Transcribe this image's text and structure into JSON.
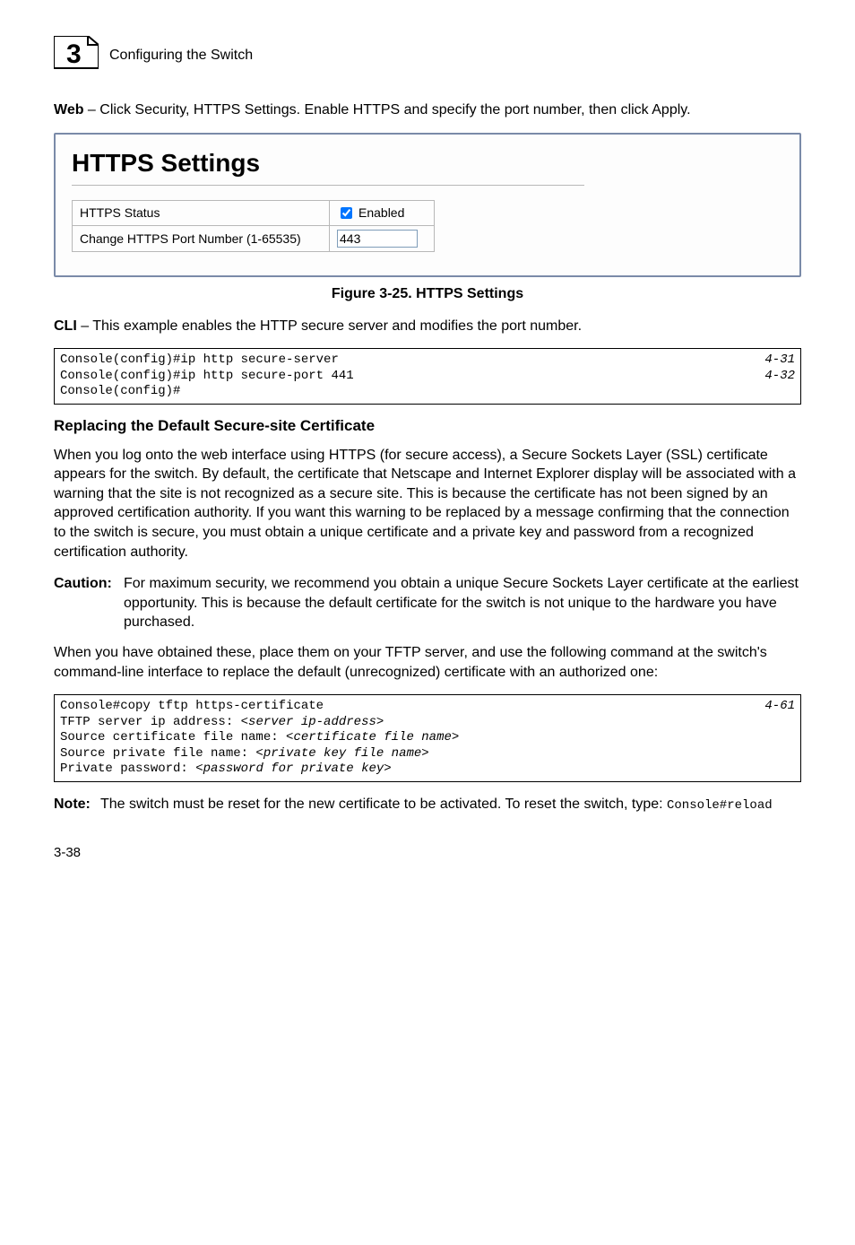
{
  "header": {
    "chapter_num": "3",
    "breadcrumb": "Configuring the Switch"
  },
  "intro_web": {
    "lead": "Web",
    "sep": " – ",
    "text": "Click Security, HTTPS Settings. Enable HTTPS and specify the port number, then click Apply."
  },
  "panel": {
    "title": "HTTPS Settings",
    "row1_label": "HTTPS Status",
    "row1_value": "Enabled",
    "row2_label": "Change HTTPS Port Number (1-65535)",
    "row2_value": "443"
  },
  "figure_caption": "Figure 3-25.  HTTPS Settings",
  "intro_cli": {
    "lead": "CLI",
    "sep": " – ",
    "text": "This example enables the HTTP secure server and modifies the port number."
  },
  "code1": {
    "lines": [
      {
        "cmd": "Console(config)#ip http secure-server",
        "ref": "4-31"
      },
      {
        "cmd": "Console(config)#ip http secure-port 441",
        "ref": "4-32"
      },
      {
        "cmd": "Console(config)#",
        "ref": ""
      }
    ]
  },
  "subheading": "Replacing the Default Secure-site Certificate",
  "para1": "When you log onto the web interface using HTTPS (for secure access), a Secure Sockets Layer (SSL) certificate appears for the switch. By default, the certificate that Netscape and Internet Explorer display will be associated with a warning that the site is not recognized as a secure site. This is because the certificate has not been signed by an approved certification authority. If you want this warning to be replaced by a message confirming that the connection to the switch is secure, you must obtain a unique certificate and a private key and password from a recognized certification authority.",
  "caution": {
    "lead": "Caution:",
    "text": "For maximum security, we recommend you obtain a unique Secure Sockets Layer certificate at the earliest opportunity. This is because the default certificate for the switch is not unique to the hardware you have purchased."
  },
  "para2": "When you have obtained these, place them on your TFTP server, and use the following command at the switch's command-line interface to replace the default (unrecognized) certificate with an authorized one:",
  "code2": {
    "line1_cmd": "Console#copy tftp https-certificate",
    "line1_ref": "4-61",
    "line2_pre": "TFTP server ip address: <",
    "line2_arg": "server ip-address",
    "line2_post": ">",
    "line3_pre": "Source certificate file name: <",
    "line3_arg": "certificate file name",
    "line3_post": ">",
    "line4_pre": "Source private file name: <",
    "line4_arg": "private key file name",
    "line4_post": ">",
    "line5_pre": "Private password: <",
    "line5_arg": "password for private key",
    "line5_post": ">"
  },
  "note": {
    "lead": "Note:",
    "text_pre": "The switch must be reset for the new certificate to be activated. To reset the switch, type: ",
    "code": "Console#reload"
  },
  "page_number": "3-38"
}
